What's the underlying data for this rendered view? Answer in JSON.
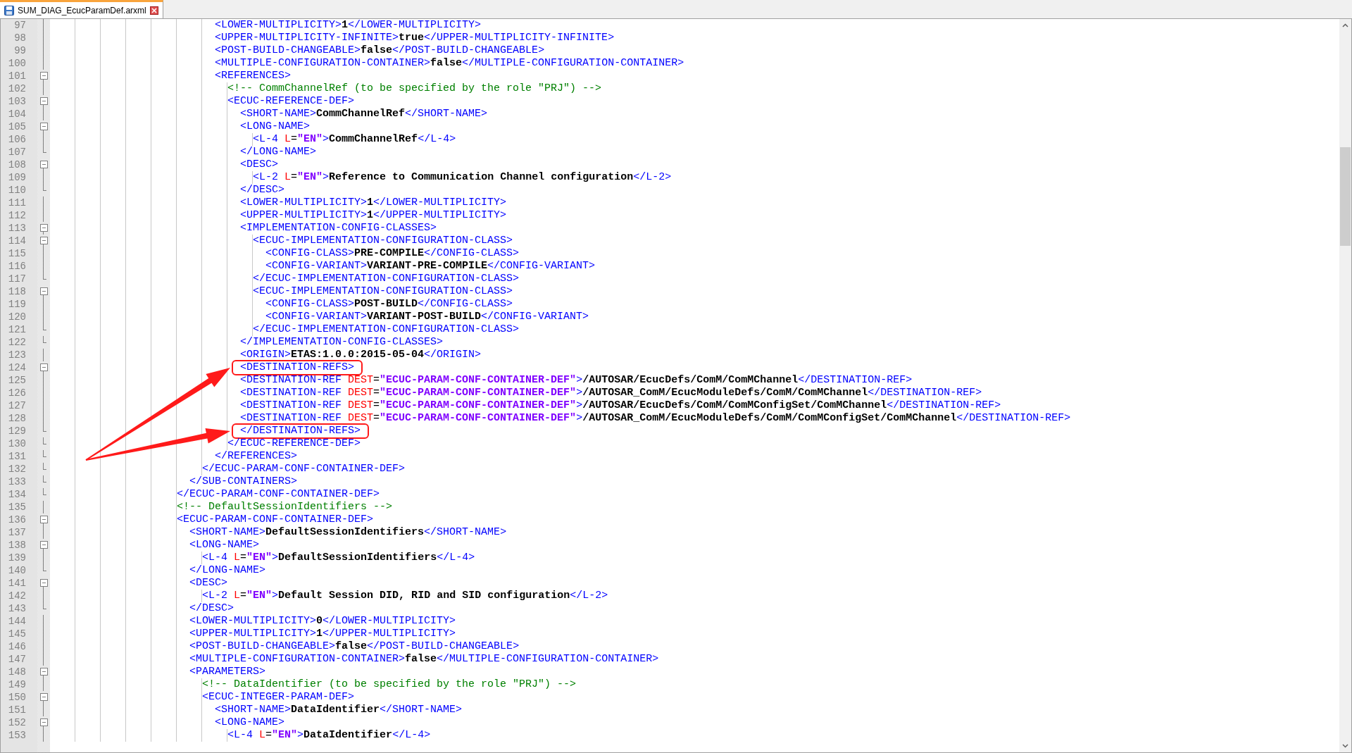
{
  "tab": {
    "title": "SUM_DIAG_EcucParamDef.arxml",
    "selected": true
  },
  "lines": [
    {
      "number": "97",
      "kind": "body",
      "highlighted": false,
      "text": "                          <LOWER-MULTIPLICITY>1</LOWER-MULTIPLICITY>"
    },
    {
      "number": "98",
      "kind": "body",
      "highlighted": false,
      "text": "                          <UPPER-MULTIPLICITY-INFINITE>true</UPPER-MULTIPLICITY-INFINITE>"
    },
    {
      "number": "99",
      "kind": "body",
      "highlighted": false,
      "text": "                          <POST-BUILD-CHANGEABLE>false</POST-BUILD-CHANGEABLE>"
    },
    {
      "number": "100",
      "kind": "body",
      "highlighted": false,
      "text": "                          <MULTIPLE-CONFIGURATION-CONTAINER>false</MULTIPLE-CONFIGURATION-CONTAINER>"
    },
    {
      "number": "101",
      "kind": "start",
      "highlighted": false,
      "text": "                          <REFERENCES>"
    },
    {
      "number": "102",
      "kind": "body",
      "highlighted": false,
      "text": "                            <!-- CommChannelRef (to be specified by the role \"PRJ\") -->"
    },
    {
      "number": "103",
      "kind": "start",
      "highlighted": false,
      "text": "                            <ECUC-REFERENCE-DEF>"
    },
    {
      "number": "104",
      "kind": "body",
      "highlighted": false,
      "text": "                              <SHORT-NAME>CommChannelRef</SHORT-NAME>"
    },
    {
      "number": "105",
      "kind": "start",
      "highlighted": false,
      "text": "                              <LONG-NAME>"
    },
    {
      "number": "106",
      "kind": "body",
      "highlighted": false,
      "text": "                                <L-4 L=\"EN\">CommChannelRef</L-4>"
    },
    {
      "number": "107",
      "kind": "end",
      "highlighted": false,
      "text": "                              </LONG-NAME>"
    },
    {
      "number": "108",
      "kind": "start",
      "highlighted": false,
      "text": "                              <DESC>"
    },
    {
      "number": "109",
      "kind": "body",
      "highlighted": false,
      "text": "                                <L-2 L=\"EN\">Reference to Communication Channel configuration</L-2>"
    },
    {
      "number": "110",
      "kind": "end",
      "highlighted": false,
      "text": "                              </DESC>"
    },
    {
      "number": "111",
      "kind": "body",
      "highlighted": false,
      "text": "                              <LOWER-MULTIPLICITY>1</LOWER-MULTIPLICITY>"
    },
    {
      "number": "112",
      "kind": "body",
      "highlighted": false,
      "text": "                              <UPPER-MULTIPLICITY>1</UPPER-MULTIPLICITY>"
    },
    {
      "number": "113",
      "kind": "start",
      "highlighted": false,
      "text": "                              <IMPLEMENTATION-CONFIG-CLASSES>"
    },
    {
      "number": "114",
      "kind": "start",
      "highlighted": false,
      "text": "                                <ECUC-IMPLEMENTATION-CONFIGURATION-CLASS>"
    },
    {
      "number": "115",
      "kind": "body",
      "highlighted": false,
      "text": "                                  <CONFIG-CLASS>PRE-COMPILE</CONFIG-CLASS>"
    },
    {
      "number": "116",
      "kind": "body",
      "highlighted": false,
      "text": "                                  <CONFIG-VARIANT>VARIANT-PRE-COMPILE</CONFIG-VARIANT>"
    },
    {
      "number": "117",
      "kind": "end",
      "highlighted": false,
      "text": "                                </ECUC-IMPLEMENTATION-CONFIGURATION-CLASS>"
    },
    {
      "number": "118",
      "kind": "start",
      "highlighted": false,
      "text": "                                <ECUC-IMPLEMENTATION-CONFIGURATION-CLASS>"
    },
    {
      "number": "119",
      "kind": "body",
      "highlighted": false,
      "text": "                                  <CONFIG-CLASS>POST-BUILD</CONFIG-CLASS>"
    },
    {
      "number": "120",
      "kind": "body",
      "highlighted": false,
      "text": "                                  <CONFIG-VARIANT>VARIANT-POST-BUILD</CONFIG-VARIANT>"
    },
    {
      "number": "121",
      "kind": "end",
      "highlighted": false,
      "text": "                                </ECUC-IMPLEMENTATION-CONFIGURATION-CLASS>"
    },
    {
      "number": "122",
      "kind": "end",
      "highlighted": false,
      "text": "                              </IMPLEMENTATION-CONFIG-CLASSES>"
    },
    {
      "number": "123",
      "kind": "body",
      "highlighted": false,
      "text": "                              <ORIGIN>ETAS:1.0.0:2015-05-04</ORIGIN>"
    },
    {
      "number": "124",
      "kind": "start",
      "highlighted": true,
      "text": "                              <DESTINATION-REFS>"
    },
    {
      "number": "125",
      "kind": "body",
      "highlighted": false,
      "text": "                              <DESTINATION-REF DEST=\"ECUC-PARAM-CONF-CONTAINER-DEF\">/AUTOSAR/EcucDefs/ComM/ComMChannel</DESTINATION-REF>"
    },
    {
      "number": "126",
      "kind": "body",
      "highlighted": false,
      "text": "                              <DESTINATION-REF DEST=\"ECUC-PARAM-CONF-CONTAINER-DEF\">/AUTOSAR_ComM/EcucModuleDefs/ComM/ComMChannel</DESTINATION-REF>"
    },
    {
      "number": "127",
      "kind": "body",
      "highlighted": false,
      "text": "                              <DESTINATION-REF DEST=\"ECUC-PARAM-CONF-CONTAINER-DEF\">/AUTOSAR/EcucDefs/ComM/ComMConfigSet/ComMChannel</DESTINATION-REF>"
    },
    {
      "number": "128",
      "kind": "body",
      "highlighted": false,
      "text": "                              <DESTINATION-REF DEST=\"ECUC-PARAM-CONF-CONTAINER-DEF\">/AUTOSAR_ComM/EcucModuleDefs/ComM/ComMConfigSet/ComMChannel</DESTINATION-REF>"
    },
    {
      "number": "129",
      "kind": "end",
      "highlighted": true,
      "text": "                              </DESTINATION-REFS>"
    },
    {
      "number": "130",
      "kind": "end",
      "highlighted": false,
      "text": "                            </ECUC-REFERENCE-DEF>"
    },
    {
      "number": "131",
      "kind": "end",
      "highlighted": false,
      "text": "                          </REFERENCES>"
    },
    {
      "number": "132",
      "kind": "end",
      "highlighted": false,
      "text": "                        </ECUC-PARAM-CONF-CONTAINER-DEF>"
    },
    {
      "number": "133",
      "kind": "end",
      "highlighted": false,
      "text": "                      </SUB-CONTAINERS>"
    },
    {
      "number": "134",
      "kind": "end",
      "highlighted": false,
      "text": "                    </ECUC-PARAM-CONF-CONTAINER-DEF>"
    },
    {
      "number": "135",
      "kind": "body",
      "highlighted": false,
      "text": "                    <!-- DefaultSessionIdentifiers -->"
    },
    {
      "number": "136",
      "kind": "start",
      "highlighted": false,
      "text": "                    <ECUC-PARAM-CONF-CONTAINER-DEF>"
    },
    {
      "number": "137",
      "kind": "body",
      "highlighted": false,
      "text": "                      <SHORT-NAME>DefaultSessionIdentifiers</SHORT-NAME>"
    },
    {
      "number": "138",
      "kind": "start",
      "highlighted": false,
      "text": "                      <LONG-NAME>"
    },
    {
      "number": "139",
      "kind": "body",
      "highlighted": false,
      "text": "                        <L-4 L=\"EN\">DefaultSessionIdentifiers</L-4>"
    },
    {
      "number": "140",
      "kind": "end",
      "highlighted": false,
      "text": "                      </LONG-NAME>"
    },
    {
      "number": "141",
      "kind": "start",
      "highlighted": false,
      "text": "                      <DESC>"
    },
    {
      "number": "142",
      "kind": "body",
      "highlighted": false,
      "text": "                        <L-2 L=\"EN\">Default Session DID, RID and SID configuration</L-2>"
    },
    {
      "number": "143",
      "kind": "end",
      "highlighted": false,
      "text": "                      </DESC>"
    },
    {
      "number": "144",
      "kind": "body",
      "highlighted": false,
      "text": "                      <LOWER-MULTIPLICITY>0</LOWER-MULTIPLICITY>"
    },
    {
      "number": "145",
      "kind": "body",
      "highlighted": false,
      "text": "                      <UPPER-MULTIPLICITY>1</UPPER-MULTIPLICITY>"
    },
    {
      "number": "146",
      "kind": "body",
      "highlighted": false,
      "text": "                      <POST-BUILD-CHANGEABLE>false</POST-BUILD-CHANGEABLE>"
    },
    {
      "number": "147",
      "kind": "body",
      "highlighted": false,
      "text": "                      <MULTIPLE-CONFIGURATION-CONTAINER>false</MULTIPLE-CONFIGURATION-CONTAINER>"
    },
    {
      "number": "148",
      "kind": "start",
      "highlighted": false,
      "text": "                      <PARAMETERS>"
    },
    {
      "number": "149",
      "kind": "body",
      "highlighted": false,
      "text": "                        <!-- DataIdentifier (to be specified by the role \"PRJ\") -->"
    },
    {
      "number": "150",
      "kind": "start",
      "highlighted": false,
      "text": "                        <ECUC-INTEGER-PARAM-DEF>"
    },
    {
      "number": "151",
      "kind": "body",
      "highlighted": false,
      "text": "                          <SHORT-NAME>DataIdentifier</SHORT-NAME>"
    },
    {
      "number": "152",
      "kind": "start",
      "highlighted": false,
      "text": "                          <LONG-NAME>"
    },
    {
      "number": "153",
      "kind": "body",
      "highlighted": false,
      "text": "                            <L-4 L=\"EN\">DataIdentifier</L-4>"
    }
  ]
}
